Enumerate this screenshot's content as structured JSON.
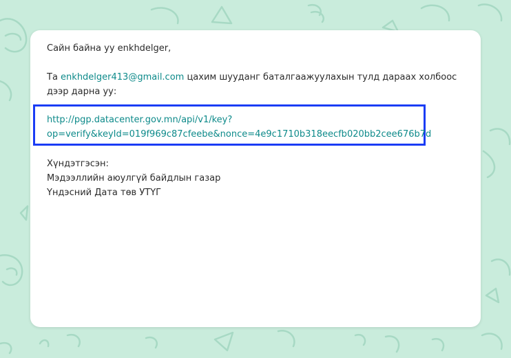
{
  "colors": {
    "background": "#c9ecdc",
    "card": "#ffffff",
    "link": "#0d8a8a",
    "highlight_box": "#1a3cf5",
    "text": "#2b2b2b"
  },
  "email": {
    "greeting": "Сайн байна уу enkhdelger,",
    "intro_prefix": "Та ",
    "intro_email": "enkhdelger413@gmail.com",
    "intro_suffix": " цахим шууданг баталгаажуулахын тулд дараах холбоос дээр дарна уу:",
    "verify_link_line1": "http://pgp.datacenter.gov.mn/api/v1/key?",
    "verify_link_line2": "op=verify&keyId=019f969c87cfeebe&nonce=4e9c1710b318eecfb020bb2cee676b7d",
    "signature": {
      "closing": "Хүндэтгэсэн:",
      "org1": "Мэдээллийн аюулгүй байдлын газар",
      "org2": "Үндэсний Дата төв УТҮГ"
    }
  }
}
